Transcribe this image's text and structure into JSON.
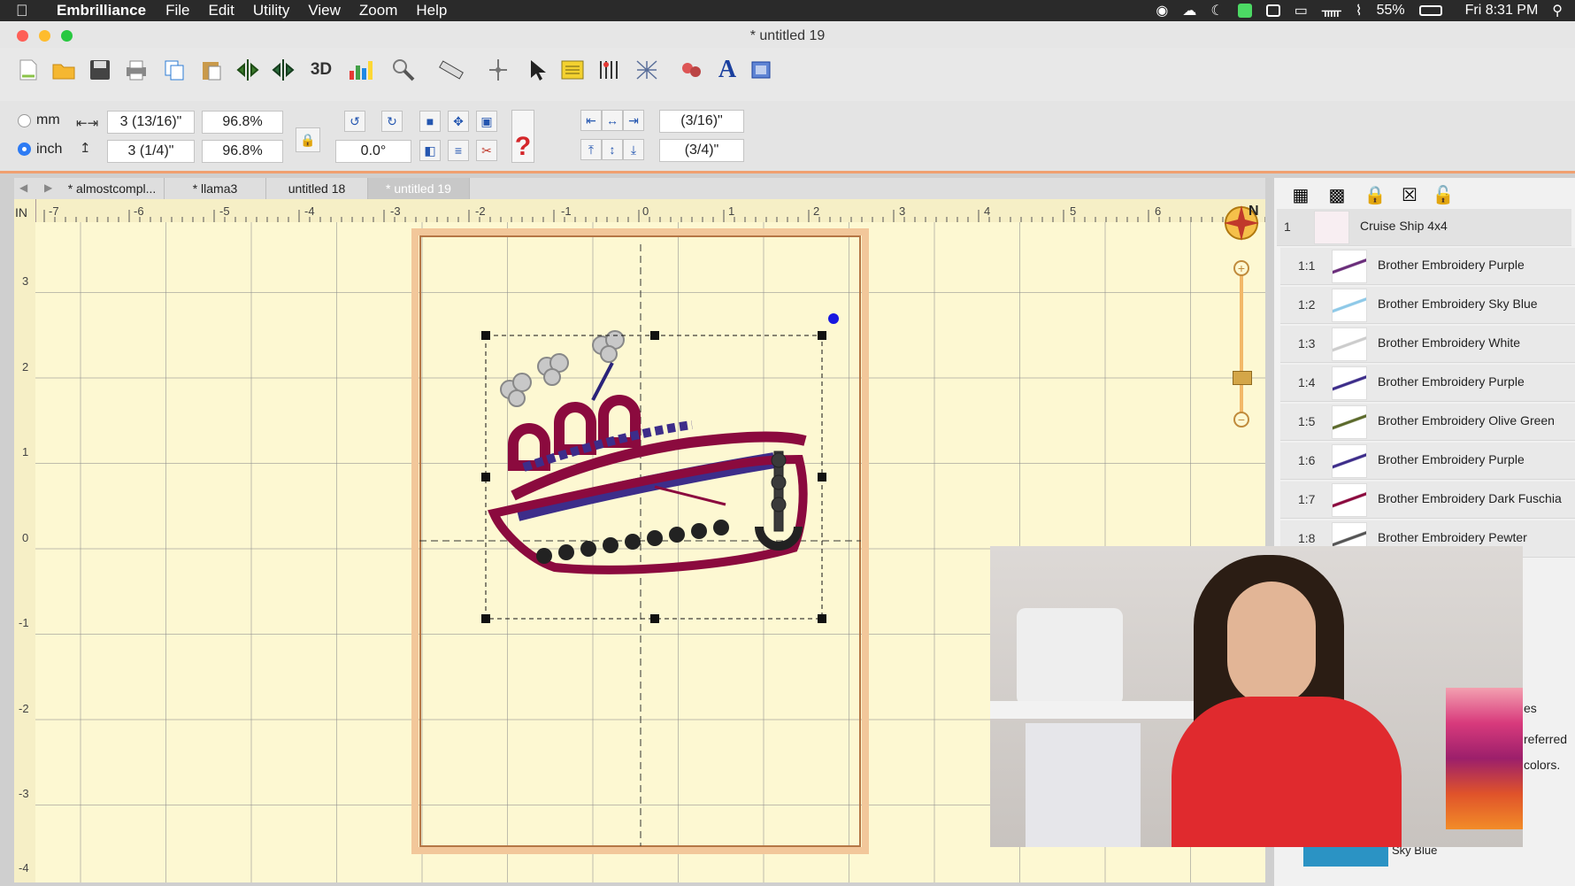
{
  "menubar": {
    "app_name": "Embrilliance",
    "menus": [
      "File",
      "Edit",
      "Utility",
      "View",
      "Zoom",
      "Help"
    ],
    "battery": "55%",
    "clock": "Fri 8:31 PM"
  },
  "window": {
    "title": "* untitled 19"
  },
  "toolbar": {
    "three_d_label": "3D"
  },
  "props": {
    "unit_mm": "mm",
    "unit_inch": "inch",
    "width_value": "3 (13/16)\"",
    "height_value": "3 (1/4)\"",
    "width_pct": "96.8%",
    "height_pct": "96.8%",
    "rotation": "0.0°",
    "spacing_h": "(3/16)\"",
    "spacing_v": "(3/4)\""
  },
  "tabs": [
    "* almostcompl...",
    "* llama3",
    "untitled 18",
    "* untitled 19"
  ],
  "ruler": {
    "unit": "IN",
    "h_labels": [
      "-7",
      "-6",
      "-5",
      "-4",
      "-3",
      "-2",
      "-1",
      "0",
      "1",
      "2",
      "3",
      "4",
      "5",
      "6"
    ],
    "v_labels": [
      "3",
      "2",
      "1",
      "0",
      "-1",
      "-2",
      "-3",
      "-4"
    ]
  },
  "compass": {
    "north": "N"
  },
  "design": {
    "index": "1",
    "name": "Cruise Ship 4x4",
    "colors": [
      {
        "num": "1:1",
        "name": "Brother Embroidery Purple",
        "color": "#6a2d7a"
      },
      {
        "num": "1:2",
        "name": "Brother Embroidery Sky Blue",
        "color": "#8ec9e8"
      },
      {
        "num": "1:3",
        "name": "Brother Embroidery White",
        "color": "#cccccc"
      },
      {
        "num": "1:4",
        "name": "Brother Embroidery Purple",
        "color": "#3d2d8a"
      },
      {
        "num": "1:5",
        "name": "Brother Embroidery Olive Green",
        "color": "#5c6a2c"
      },
      {
        "num": "1:6",
        "name": "Brother Embroidery Purple",
        "color": "#3d2d8a"
      },
      {
        "num": "1:7",
        "name": "Brother Embroidery Dark Fuschia",
        "color": "#8b0a3e"
      },
      {
        "num": "1:8",
        "name": "Brother Embroidery Pewter",
        "color": "#555555"
      }
    ]
  },
  "panel_partial": {
    "text1": "es",
    "text2": "referred",
    "text3": "colors."
  },
  "swatch": {
    "name": "Sky Blue",
    "color": "#2b93c4"
  }
}
